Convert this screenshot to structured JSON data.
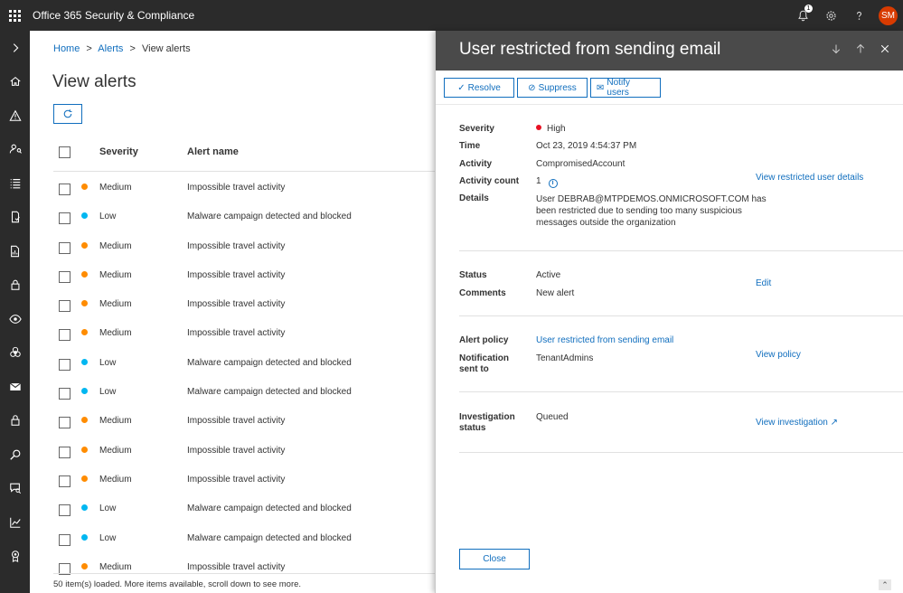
{
  "app": {
    "title": "Office 365 Security & Compliance",
    "notifications_count": "1",
    "user_initials": "SM",
    "accent": "#d83b01"
  },
  "nav": {
    "expand_icon": "chevron-right-icon",
    "items": [
      "home-icon",
      "alert-icon",
      "people-search-icon",
      "list-icon",
      "mobile-policy-icon",
      "report-doc-icon",
      "lock-icon",
      "eye-icon",
      "biohazard-icon",
      "mail-icon",
      "padlock-icon",
      "search-icon",
      "chat-search-icon",
      "chart-icon",
      "badge-icon"
    ]
  },
  "breadcrumb": {
    "home": "Home",
    "alerts": "Alerts",
    "current": "View alerts",
    "separator": ">"
  },
  "page": {
    "title": "View alerts"
  },
  "table": {
    "columns": {
      "severity": "Severity",
      "alert_name": "Alert name"
    },
    "rows": [
      {
        "severity": "Medium",
        "name": "Impossible travel activity",
        "color": "#ff8c00"
      },
      {
        "severity": "Low",
        "name": "Malware campaign detected and blocked",
        "color": "#00b7f1"
      },
      {
        "severity": "Medium",
        "name": "Impossible travel activity",
        "color": "#ff8c00"
      },
      {
        "severity": "Medium",
        "name": "Impossible travel activity",
        "color": "#ff8c00"
      },
      {
        "severity": "Medium",
        "name": "Impossible travel activity",
        "color": "#ff8c00"
      },
      {
        "severity": "Medium",
        "name": "Impossible travel activity",
        "color": "#ff8c00"
      },
      {
        "severity": "Low",
        "name": "Malware campaign detected and blocked",
        "color": "#00b7f1"
      },
      {
        "severity": "Low",
        "name": "Malware campaign detected and blocked",
        "color": "#00b7f1"
      },
      {
        "severity": "Medium",
        "name": "Impossible travel activity",
        "color": "#ff8c00"
      },
      {
        "severity": "Medium",
        "name": "Impossible travel activity",
        "color": "#ff8c00"
      },
      {
        "severity": "Medium",
        "name": "Impossible travel activity",
        "color": "#ff8c00"
      },
      {
        "severity": "Low",
        "name": "Malware campaign detected and blocked",
        "color": "#00b7f1"
      },
      {
        "severity": "Low",
        "name": "Malware campaign detected and blocked",
        "color": "#00b7f1"
      },
      {
        "severity": "Medium",
        "name": "Impossible travel activity",
        "color": "#ff8c00"
      }
    ],
    "footer": "50 item(s) loaded. More items available, scroll down to see more."
  },
  "panel": {
    "title": "User restricted from sending email",
    "actions": {
      "resolve": "Resolve",
      "suppress": "Suppress",
      "notify": "Notify users"
    },
    "details": {
      "severity_label": "Severity",
      "severity_value": "High",
      "severity_color": "#e81123",
      "time_label": "Time",
      "time_value": "Oct 23, 2019 4:54:37 PM",
      "activity_label": "Activity",
      "activity_value": "CompromisedAccount",
      "activity_count_label": "Activity count",
      "activity_count_value": "1",
      "details_label": "Details",
      "details_line1": "User DEBRAB@MTPDEMOS.ONMICROSOFT.COM has",
      "details_line2": "been restricted due to sending too many suspicious",
      "details_line3": "messages outside the organization",
      "view_user_link": "View restricted user details"
    },
    "status": {
      "status_label": "Status",
      "status_value": "Active",
      "comments_label": "Comments",
      "comments_value": "New alert",
      "edit_link": "Edit"
    },
    "policy": {
      "alert_policy_label": "Alert policy",
      "alert_policy_value": "User restricted from sending email",
      "notification_label_1": "Notification",
      "notification_label_2": "sent to",
      "notification_value": "TenantAdmins",
      "view_policy_link": "View policy"
    },
    "investigation": {
      "label_1": "Investigation",
      "label_2": "status",
      "value": "Queued",
      "view_link": "View investigation"
    },
    "close": "Close"
  }
}
